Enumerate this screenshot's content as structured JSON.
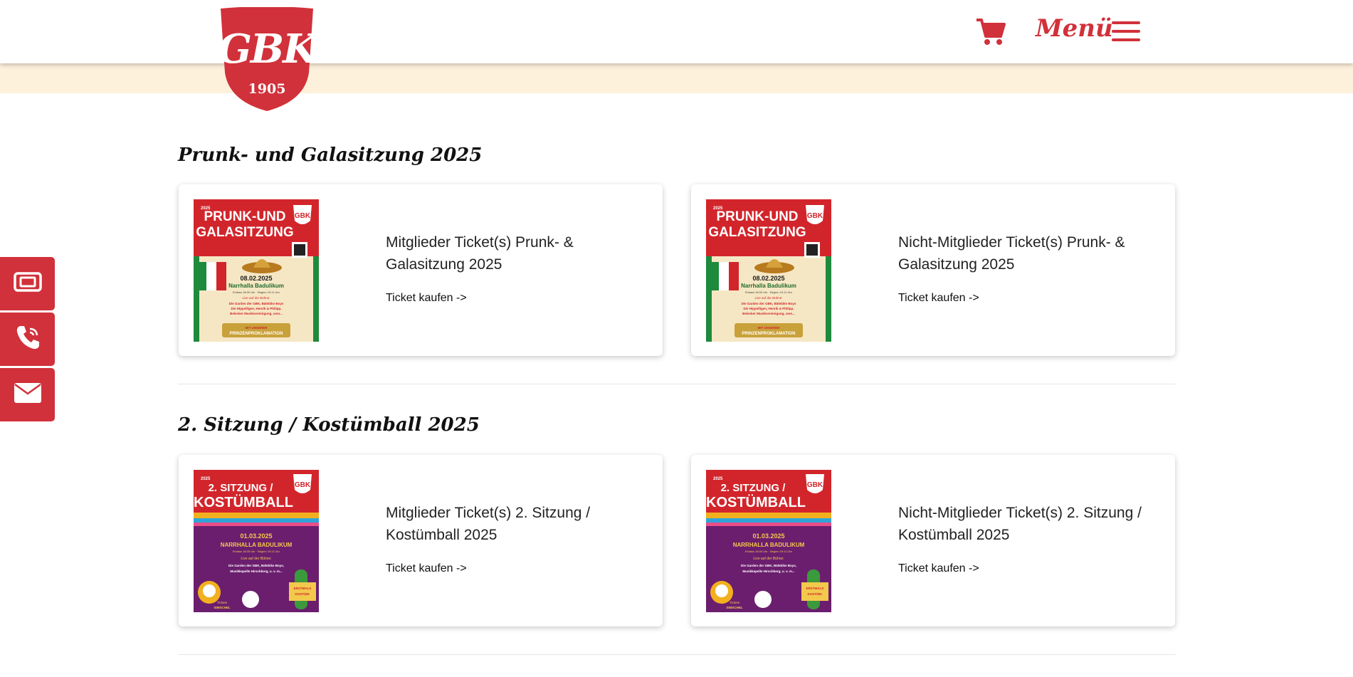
{
  "logo": {
    "main": "GBK",
    "year": "1905"
  },
  "header": {
    "menu_label": "Menü"
  },
  "colors": {
    "brand_red": "#d1313a",
    "cream": "#fdf1dc",
    "poster_purple": "#6b1e6e"
  },
  "side_buttons": [
    {
      "icon": "ticket-icon"
    },
    {
      "icon": "phone-icon"
    },
    {
      "icon": "mail-icon"
    }
  ],
  "sections": [
    {
      "title": "Prunk- und Galasitzung 2025",
      "cards": [
        {
          "title": "Mitglieder Ticket(s) Prunk- & Galasitzung 2025",
          "link": "Ticket kaufen ->",
          "poster": {
            "year": "2025",
            "line1": "PRUNK-UND",
            "line2": "GALASITZUNG",
            "badge": "GBK",
            "date": "08.02.2025",
            "venue": "Narrhalla Badulikum",
            "info1": "Einlass 18:00 Uhr · Beginn 19:11 Uhr",
            "info2": "Live auf der Bühne:",
            "acts1": "Die Garden der GBK, Bälebike Boys",
            "acts2": "Die Hippelligen, Henrik & Philipp,",
            "acts3": "Belecker Musikvereinigung, uvm...",
            "footer1": "MIT UNSERER",
            "footer2": "PRINZENPROKLAMATION"
          }
        },
        {
          "title": "Nicht-Mitglieder Ticket(s) Prunk- & Galasitzung 2025",
          "link": "Ticket kaufen ->",
          "poster": {
            "year": "2025",
            "line1": "PRUNK-UND",
            "line2": "GALASITZUNG",
            "badge": "GBK",
            "date": "08.02.2025",
            "venue": "Narrhalla Badulikum",
            "info1": "Einlass 18:00 Uhr · Beginn 19:11 Uhr",
            "info2": "Live auf der Bühne:",
            "acts1": "Die Garden der GBK, Bälebike Boys",
            "acts2": "Die Hippelligen, Henrik & Philipp,",
            "acts3": "Belecker Musikvereinigung, uvm...",
            "footer1": "MIT UNSERER",
            "footer2": "PRINZENPROKLAMATION"
          }
        }
      ]
    },
    {
      "title": "2. Sitzung / Kostümball 2025",
      "cards": [
        {
          "title": "Mitglieder Ticket(s) 2. Sitzung / Kostümball 2025",
          "link": "Ticket kaufen ->",
          "poster": {
            "year": "2025",
            "line1": "2. SITZUNG /",
            "line2": "KOSTÜMBALL",
            "badge": "GBK",
            "date": "01.03.2025",
            "venue": "NARRHALLA BADULIKUM",
            "info1": "Einlass 18:00 Uhr · Beginn 19:11 Uhr",
            "info2": "Live auf der Bühne:",
            "acts1": "Die Garden der GBK, Bälebike Boys,",
            "acts2": "Musikkapelle Hirschberg, u. v. m...",
            "sticker1": "ERSTMALS",
            "sticker2": "KOSTÜM-",
            "footer1": "Tickets",
            "footer2": "SIMSCHEL"
          }
        },
        {
          "title": "Nicht-Mitglieder Ticket(s) 2. Sitzung / Kostümball 2025",
          "link": "Ticket kaufen ->",
          "poster": {
            "year": "2025",
            "line1": "2. SITZUNG /",
            "line2": "KOSTÜMBALL",
            "badge": "GBK",
            "date": "01.03.2025",
            "venue": "NARRHALLA BADULIKUM",
            "info1": "Einlass 18:00 Uhr · Beginn 19:11 Uhr",
            "info2": "Live auf der Bühne:",
            "acts1": "Die Garden der GBK, Bälebike Boys,",
            "acts2": "Musikkapelle Hirschberg, u. v. m...",
            "sticker1": "ERSTMALS",
            "sticker2": "KOSTÜM-",
            "footer1": "Tickets",
            "footer2": "SIMSCHEL"
          }
        }
      ]
    }
  ]
}
